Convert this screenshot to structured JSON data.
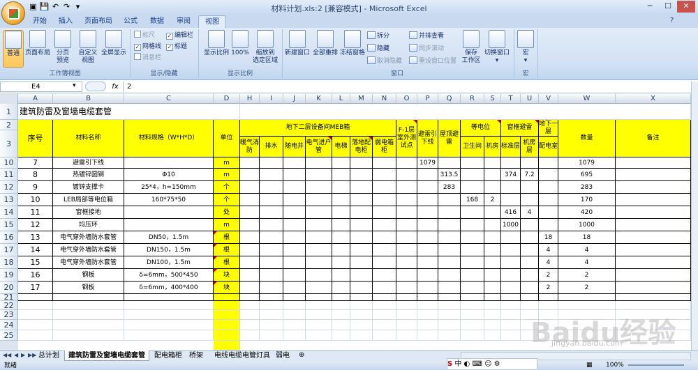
{
  "window": {
    "title": "材料计划.xls:2  [兼容模式] - Microsoft Excel"
  },
  "tabs": [
    "开始",
    "插入",
    "页面布局",
    "公式",
    "数据",
    "审阅",
    "视图"
  ],
  "active_tab": "视图",
  "ribbon": {
    "views": {
      "label": "工作簿视图",
      "normal": "普通",
      "page_layout": "页面布局",
      "page_break_1": "分页",
      "page_break_2": "预览",
      "custom_1": "自定义",
      "custom_2": "视图",
      "fullscreen": "全屏显示"
    },
    "show": {
      "label": "显示/隐藏",
      "ruler": "标尺",
      "gridlines": "网格线",
      "message_bar": "消息栏",
      "formula_bar": "编辑栏",
      "headings": "标题"
    },
    "zoom": {
      "label": "显示比例",
      "zoom": "显示比例",
      "zoom100": "100%",
      "zoom_sel_1": "缩放到",
      "zoom_sel_2": "选定区域"
    },
    "window": {
      "label": "窗口",
      "new_window": "新建窗口",
      "arrange_all": "全部重排",
      "freeze": "冻结窗格",
      "split": "拆分",
      "hide": "隐藏",
      "unhide": "取消隐藏",
      "side_by_side": "并排查看",
      "sync_scroll": "同步滚动",
      "reset_pos": "重设窗口位置",
      "save_ws_1": "保存",
      "save_ws_2": "工作区",
      "switch_1": "切换窗口"
    },
    "macros": {
      "label": "宏",
      "macros": "宏"
    }
  },
  "formula_bar": {
    "name_box": "E4",
    "fx": "fx",
    "value": "2"
  },
  "columns": [
    "A",
    "B",
    "C",
    "D",
    "H",
    "I",
    "J",
    "K",
    "L",
    "M",
    "N",
    "O",
    "P",
    "Q",
    "R",
    "S",
    "T",
    "U",
    "V",
    "W",
    "X"
  ],
  "sheet": {
    "title": "建筑防雷及窗墙电缆套管",
    "headers": {
      "seq": "序号",
      "name": "材料名称",
      "spec": "材料规格（W*H*D）",
      "unit": "单位",
      "group_meb": "地下二层设备间MEB箱",
      "sub_meb": [
        "暖气消防",
        "排水",
        "随电井",
        "电气进户管",
        "电梯",
        "落地配电柜",
        "弱电箱柜"
      ],
      "f1": "F-1层室外测试点",
      "lightning": "避雷引下线",
      "roof": "屋顶避雷",
      "equip": "等电位",
      "sub_equip": [
        "卫生间",
        "机房"
      ],
      "window_lp": "窗框避雷",
      "sub_window": [
        "标准层",
        "机房层"
      ],
      "b1": "地下一层",
      "sub_b1": "配电室",
      "qty": "数量",
      "note": "备注"
    },
    "row_numbers": [
      "1",
      "2",
      "3",
      "10",
      "11",
      "12",
      "13",
      "14",
      "15",
      "16",
      "17",
      "18",
      "19",
      "20",
      "21",
      "22",
      "23",
      "24",
      "25"
    ],
    "rows": [
      {
        "seq": "7",
        "name": "避雷引下线",
        "spec": "",
        "unit": "m",
        "P": "1079",
        "Q": "",
        "R": "",
        "S": "",
        "T": "",
        "U": "",
        "V": "",
        "W": "1079"
      },
      {
        "seq": "8",
        "name": "热镀锌圆钢",
        "spec": "Φ10",
        "unit": "m",
        "P": "",
        "Q": "313.5",
        "R": "",
        "S": "",
        "T": "374",
        "U": "7.2",
        "V": "",
        "W": "695"
      },
      {
        "seq": "9",
        "name": "镀锌支撑卡",
        "spec": "25*4，h=150mm",
        "unit": "个",
        "P": "",
        "Q": "283",
        "R": "",
        "S": "",
        "T": "",
        "U": "",
        "V": "",
        "W": "283"
      },
      {
        "seq": "10",
        "name": "LEB局部等电位箱",
        "spec": "160*75*50",
        "unit": "个",
        "P": "",
        "Q": "",
        "R": "168",
        "S": "2",
        "T": "",
        "U": "",
        "V": "",
        "W": "170"
      },
      {
        "seq": "11",
        "name": "窗框接地",
        "spec": "",
        "unit": "处",
        "P": "",
        "Q": "",
        "R": "",
        "S": "",
        "T": "416",
        "U": "4",
        "V": "",
        "W": "420"
      },
      {
        "seq": "12",
        "name": "均压环",
        "spec": "",
        "unit": "m",
        "P": "",
        "Q": "",
        "R": "",
        "S": "",
        "T": "1000",
        "U": "",
        "V": "",
        "W": "1000"
      },
      {
        "seq": "13",
        "name": "电气穿外墙防水套管",
        "spec": "DN50，1.5m",
        "unit": "根",
        "P": "",
        "Q": "",
        "R": "",
        "S": "",
        "T": "",
        "U": "",
        "V": "18",
        "W": "18"
      },
      {
        "seq": "14",
        "name": "电气穿外墙防水套管",
        "spec": "DN150，1.5m",
        "unit": "根",
        "P": "",
        "Q": "",
        "R": "",
        "S": "",
        "T": "",
        "U": "",
        "V": "4",
        "W": "4"
      },
      {
        "seq": "15",
        "name": "电气穿外墙防水套管",
        "spec": "DN100，1.5m",
        "unit": "根",
        "P": "",
        "Q": "",
        "R": "",
        "S": "",
        "T": "",
        "U": "",
        "V": "4",
        "W": "4"
      },
      {
        "seq": "16",
        "name": "钢板",
        "spec": "δ=6mm，500*450",
        "unit": "块",
        "P": "",
        "Q": "",
        "R": "",
        "S": "",
        "T": "",
        "U": "",
        "V": "2",
        "W": "2"
      },
      {
        "seq": "17",
        "name": "钢板",
        "spec": "δ=6mm，400*400",
        "unit": "块",
        "P": "",
        "Q": "",
        "R": "",
        "S": "",
        "T": "",
        "U": "",
        "V": "2",
        "W": "2"
      }
    ]
  },
  "sheet_tabs": [
    "总计划",
    "建筑防雷及窗墙电缆套管",
    "配电箱柜",
    "桥架",
    "电线电缆电管灯具",
    "弱电"
  ],
  "active_sheet": "建筑防雷及窗墙电缆套管",
  "status": {
    "ready": "就绪",
    "zoom": "100%"
  },
  "watermark": {
    "text": "Baidu经验",
    "url": "jingyan.baidu.com"
  },
  "colors": {
    "header_yellow": "#ffff00",
    "ribbon_blue": "#d2e1f4",
    "title_gradient": "#c9dbf1"
  }
}
